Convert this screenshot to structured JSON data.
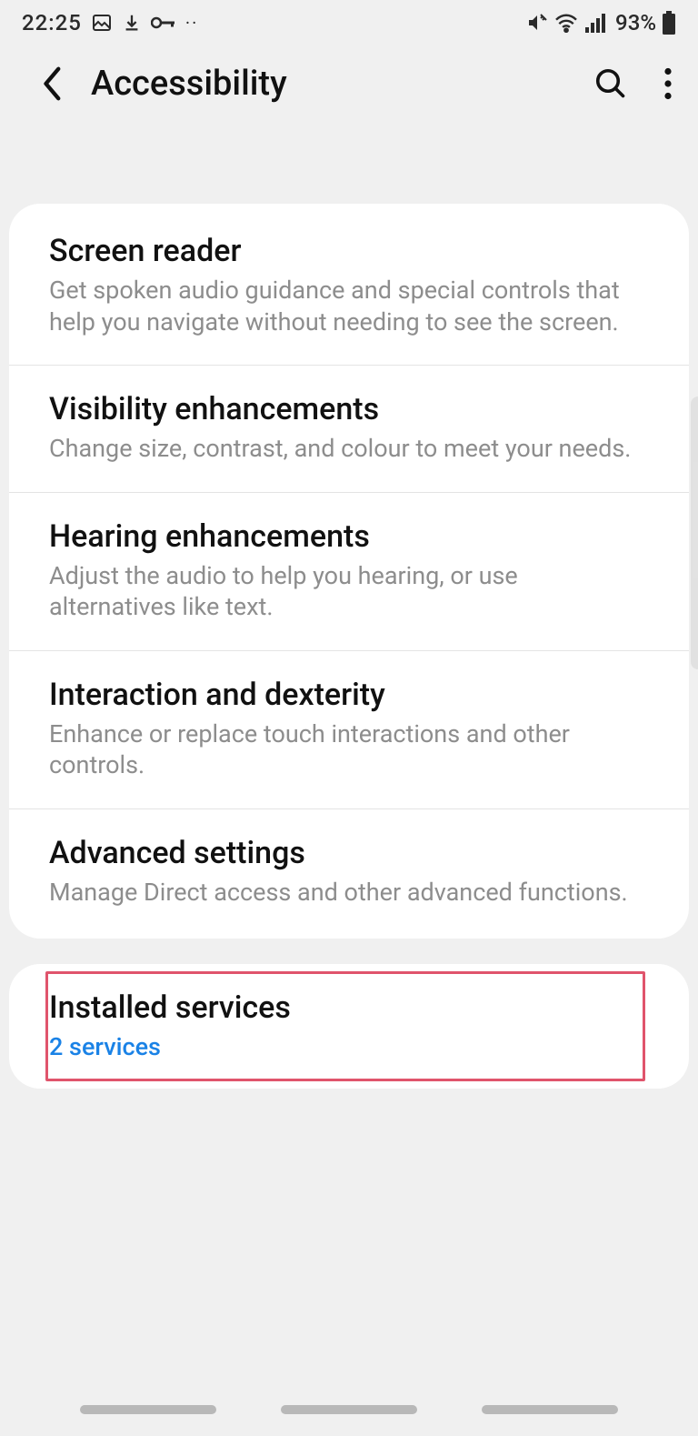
{
  "status_bar": {
    "time": "22:25",
    "battery_percent": "93%"
  },
  "header": {
    "title": "Accessibility"
  },
  "settings": [
    {
      "title": "Screen reader",
      "desc": "Get spoken audio guidance and special controls that help you navigate without needing to see the screen."
    },
    {
      "title": "Visibility enhancements",
      "desc": "Change size, contrast, and colour to meet your needs."
    },
    {
      "title": "Hearing enhancements",
      "desc": "Adjust the audio to help you hearing, or use alternatives like text."
    },
    {
      "title": "Interaction and dexterity",
      "desc": "Enhance or replace touch interactions and other controls."
    },
    {
      "title": "Advanced settings",
      "desc": "Manage Direct access and other advanced functions."
    }
  ],
  "installed_services": {
    "title": "Installed services",
    "subtitle": "2 services"
  }
}
